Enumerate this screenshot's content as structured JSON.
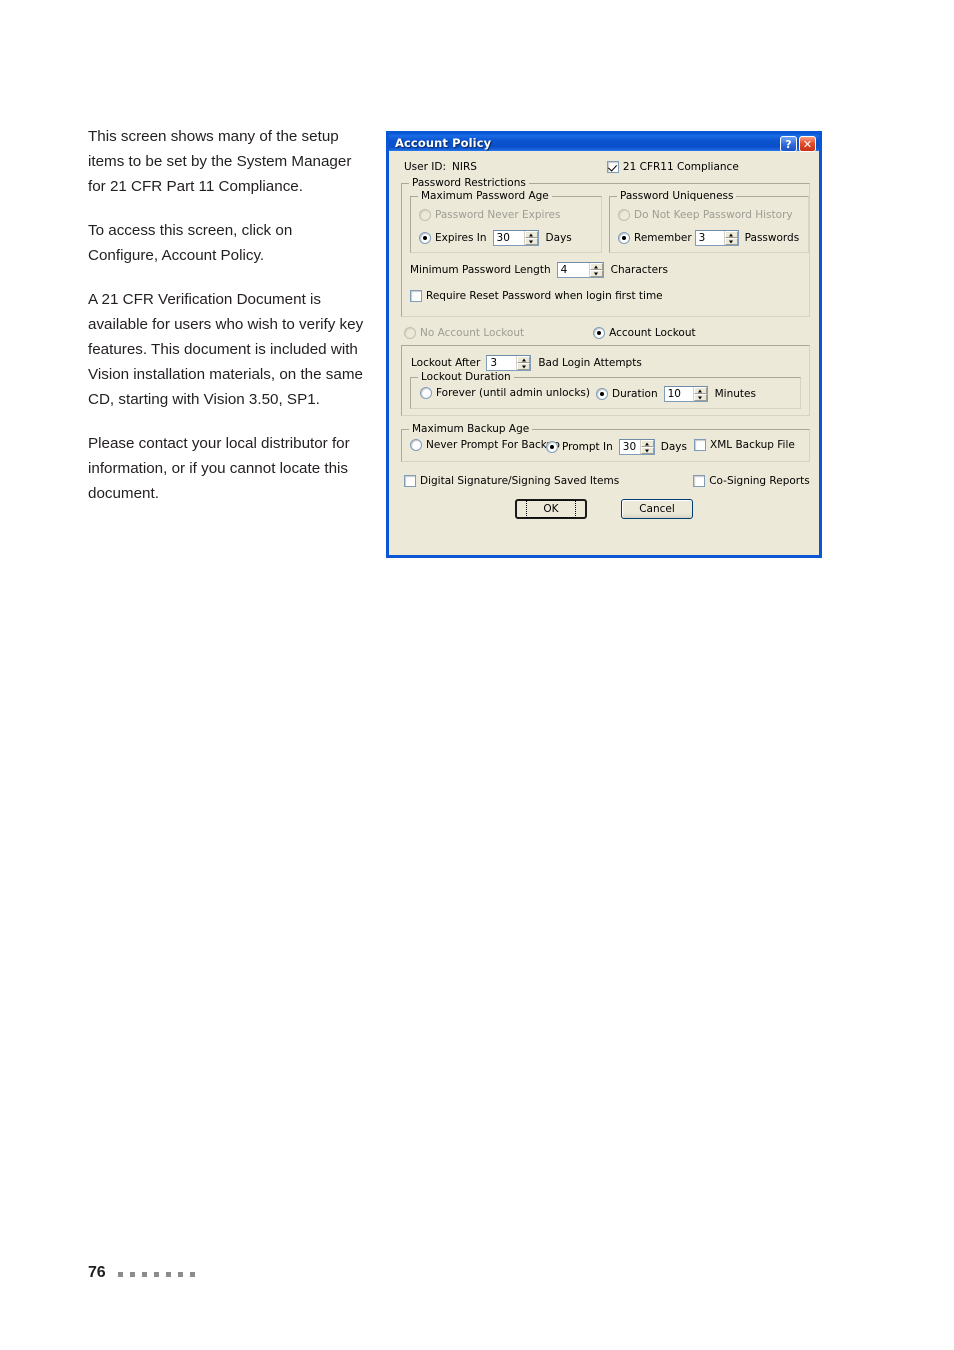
{
  "page": {
    "number": "76",
    "footer_dot_count": 7,
    "footer_dot_color": "#8c8c8c"
  },
  "body_text": {
    "paragraphs": [
      "This screen shows many of the setup items to be set by the System Manager for 21 CFR Part 11 Compliance.",
      "To access this screen, click on Configure, Account Policy.",
      "A 21 CFR Verification Document is available for users who wish to verify key features. This document is included with Vision installation materials, on the same CD, starting with Vision 3.50, SP1.",
      "Please contact your local distributor for information, or if you cannot locate this document."
    ]
  },
  "dialog": {
    "title": "Account Policy",
    "titlebar_color": "#0a57d6",
    "help_button": "?",
    "close_button": "✕",
    "user_id_label": "User ID:",
    "user_id_value": "NIRS",
    "compliance_checkbox": {
      "label": "21 CFR11 Compliance",
      "checked": true
    },
    "password_restrictions": {
      "title": "Password Restrictions",
      "maximum_password_age": {
        "title": "Maximum Password Age",
        "never_expires": {
          "label": "Password Never Expires",
          "selected": false,
          "disabled": true
        },
        "expires_in": {
          "label": "Expires In",
          "selected": true,
          "value": "30",
          "unit": "Days"
        }
      },
      "password_uniqueness": {
        "title": "Password Uniqueness",
        "no_history": {
          "label": "Do Not Keep Password History",
          "selected": false,
          "disabled": true
        },
        "remember": {
          "label": "Remember",
          "selected": true,
          "value": "3",
          "unit": "Passwords"
        }
      },
      "minimum_password_length": {
        "label": "Minimum Password Length",
        "value": "4",
        "unit": "Characters"
      },
      "require_reset": {
        "label": "Require Reset Password when login first time",
        "checked": false
      }
    },
    "account_lockout": {
      "no_lockout": {
        "label": "No Account Lockout",
        "selected": false,
        "disabled": true
      },
      "lockout": {
        "label": "Account Lockout",
        "selected": true
      },
      "lockout_after": {
        "label": "Lockout After",
        "value": "3",
        "unit": "Bad Login Attempts"
      },
      "lockout_duration": {
        "title": "Lockout Duration",
        "forever": {
          "label": "Forever (until admin unlocks)",
          "selected": false
        },
        "duration": {
          "label": "Duration",
          "selected": true,
          "value": "10",
          "unit": "Minutes"
        }
      }
    },
    "maximum_backup_age": {
      "title": "Maximum Backup Age",
      "never_prompt": {
        "label": "Never Prompt For Backup",
        "selected": false
      },
      "prompt_in": {
        "label": "Prompt In",
        "selected": true,
        "value": "30",
        "unit": "Days"
      },
      "xml_backup_file": {
        "label": "XML Backup File",
        "checked": false
      }
    },
    "digital_signature": {
      "label": "Digital Signature/Signing Saved Items",
      "checked": false
    },
    "co_signing_reports": {
      "label": "Co-Signing Reports",
      "checked": false
    },
    "buttons": {
      "ok": "OK",
      "cancel": "Cancel"
    }
  }
}
